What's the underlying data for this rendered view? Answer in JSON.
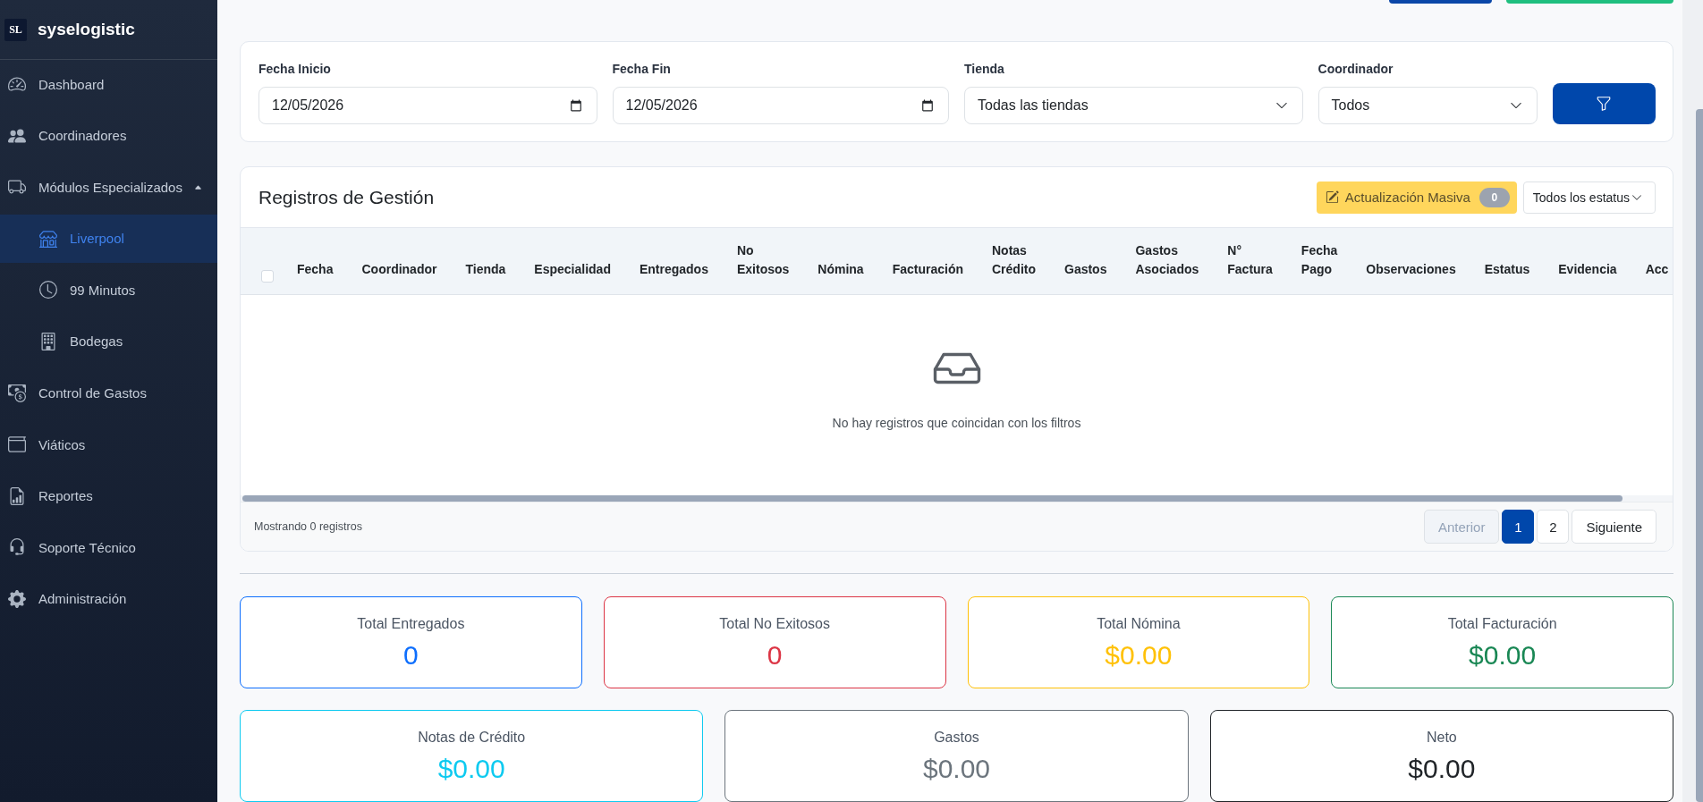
{
  "header_actions": [
    {
      "kind": "primary"
    },
    {
      "kind": "success"
    }
  ],
  "sidebar": {
    "logo_mark": "SL",
    "brand": "syselogistic",
    "items": [
      {
        "label": "Dashboard",
        "selected": false
      },
      {
        "label": "Coordinadores",
        "selected": false
      },
      {
        "label": "Módulos Especializados",
        "selected": false,
        "expanded": true,
        "children": [
          {
            "label": "Liverpool",
            "selected": true
          },
          {
            "label": "99 Minutos",
            "selected": false
          },
          {
            "label": "Bodegas",
            "selected": false
          }
        ]
      },
      {
        "label": "Control de Gastos",
        "selected": false
      },
      {
        "label": "Viáticos",
        "selected": false
      },
      {
        "label": "Reportes",
        "selected": false
      },
      {
        "label": "Soporte Técnico",
        "selected": false
      },
      {
        "label": "Administración",
        "selected": false
      }
    ]
  },
  "filters": [
    {
      "kind": "date",
      "label": "Fecha Inicio",
      "value": "12/05/2026"
    },
    {
      "kind": "date",
      "label": "Fecha Fin",
      "value": "12/05/2026"
    },
    {
      "kind": "select",
      "label": "Tienda",
      "value": "Todas las tiendas"
    },
    {
      "kind": "select",
      "label": "Coordinador",
      "value": "Todos"
    }
  ],
  "records": {
    "title": "Registros de Gestión",
    "bulk_update": {
      "label": "Actualización Masiva",
      "count": "0"
    },
    "status_filter": {
      "value": "Todos los estatus"
    },
    "select_all": {
      "checked": false
    },
    "columns": [
      "Fecha",
      "Coordinador",
      "Tienda",
      "Especialidad",
      "Entregados",
      "No Exitosos",
      "Nómina",
      "Facturación",
      "Notas Crédito",
      "Gastos",
      "Gastos Asociados",
      "N° Factura",
      "Fecha Pago",
      "Observaciones",
      "Estatus",
      "Evidencia",
      "Acc"
    ],
    "empty_message": "No hay registros que coincidan con los filtros",
    "summary": "Mostrando 0 registros",
    "pagination": {
      "previous": {
        "label": "Anterior",
        "disabled": true
      },
      "pages": [
        {
          "label": "1",
          "selected": true
        },
        {
          "label": "2",
          "selected": false
        }
      ],
      "next": {
        "label": "Siguiente",
        "disabled": false
      }
    }
  },
  "totals": [
    {
      "cards": [
        {
          "label": "Total Entregados",
          "value": "0",
          "color": "#0d6efd"
        },
        {
          "label": "Total No Exitosos",
          "value": "0",
          "color": "#dc3545"
        },
        {
          "label": "Total Nómina",
          "value": "$0.00",
          "color": "#ffc107"
        },
        {
          "label": "Total Facturación",
          "value": "$0.00",
          "color": "#198754"
        }
      ]
    },
    {
      "cards": [
        {
          "label": "Notas de Crédito",
          "value": "$0.00",
          "color": "#0dcaf0"
        },
        {
          "label": "Gastos",
          "value": "$0.00",
          "color": "#6c757d"
        },
        {
          "label": "Neto",
          "value": "$0.00",
          "color": "#212529"
        }
      ]
    }
  ]
}
